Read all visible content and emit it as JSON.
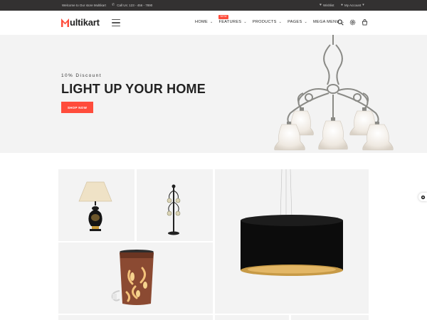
{
  "topbar": {
    "welcome": "Welcome to Our store Multikart",
    "phone": "Call Us: 123 - 456 - 7890",
    "wishlist": "Wishlist",
    "account": "My Account"
  },
  "header": {
    "logo_text": "ultikart",
    "nav": [
      {
        "label": "HOME"
      },
      {
        "label": "FEATURES",
        "badge": "NEW"
      },
      {
        "label": "PRODUCTS"
      },
      {
        "label": "PAGES"
      },
      {
        "label": "MEGA MENU"
      }
    ],
    "icons": [
      "search-icon",
      "settings-icon",
      "cart-icon"
    ]
  },
  "hero": {
    "discount": "10% Discount",
    "title": "LIGHT UP YOUR HOME",
    "button": "SHOP NOW"
  },
  "colors": {
    "accent": "#ff4c3b",
    "topbar_bg": "#333131",
    "hero_bg": "#f3f3f3"
  }
}
